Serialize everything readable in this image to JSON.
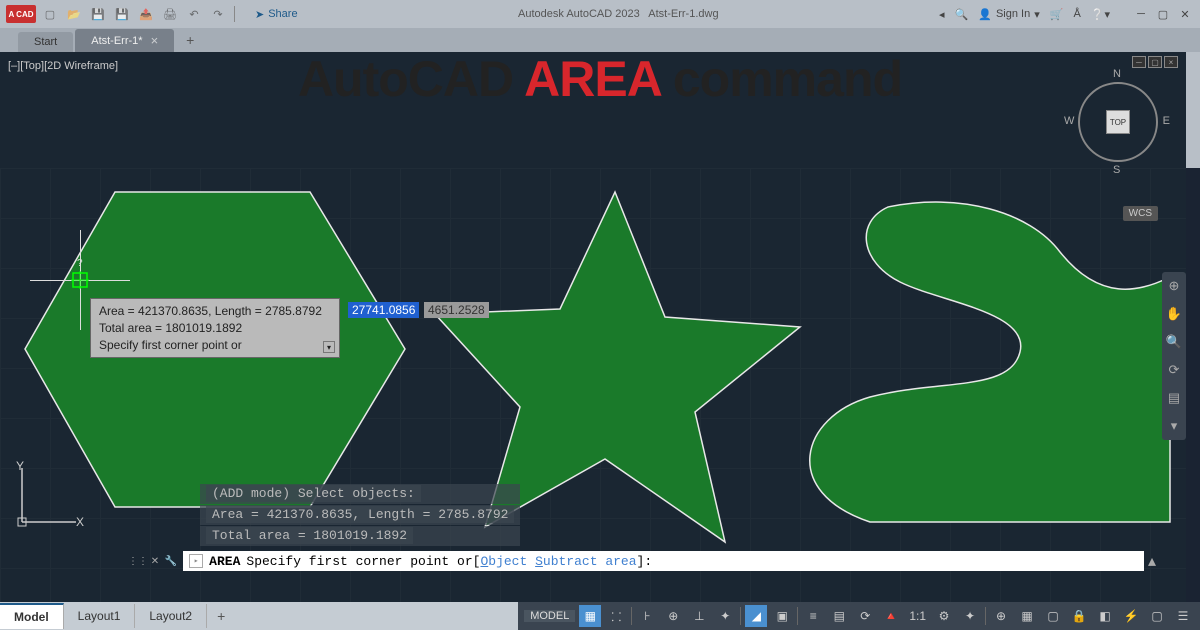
{
  "app": {
    "icon_text": "A CAD",
    "title": "Autodesk AutoCAD 2023",
    "doc_name": "Atst-Err-1.dwg",
    "share": "Share",
    "signin": "Sign In"
  },
  "doc_tabs": {
    "start": "Start",
    "active": "Atst-Err-1*"
  },
  "viewport_label": "[–][Top][2D Wireframe]",
  "overlay": {
    "part1": "AutoCAD ",
    "part2": "AREA",
    "part3": " command"
  },
  "viewcube": {
    "face": "TOP",
    "n": "N",
    "s": "S",
    "e": "E",
    "w": "W",
    "wcs": "WCS"
  },
  "tooltip": {
    "line1": "Area = 421370.8635, Length = 2785.8792",
    "line2": "Total area = 1801019.1892",
    "line3": "Specify first corner point or"
  },
  "dynamic_input": {
    "x": "27741.0856",
    "y": "4651.2528"
  },
  "cmd_history": {
    "l1": "(ADD mode) Select objects:",
    "l2": "Area = 421370.8635, Length = 2785.8792",
    "l3": "Total area = 1801019.1892"
  },
  "cmd_line": {
    "cmd": "AREA",
    "prompt": "Specify first corner point or ",
    "opt1": "Object",
    "opt2": "Subtract area",
    "end": ":",
    "u1": "O",
    "u2": "S"
  },
  "layout_tabs": {
    "model": "Model",
    "l1": "Layout1",
    "l2": "Layout2"
  },
  "status": {
    "model": "MODEL",
    "ratio": "1:1"
  },
  "ucs": {
    "x": "X",
    "y": "Y"
  },
  "cross": {
    "q": "?"
  }
}
